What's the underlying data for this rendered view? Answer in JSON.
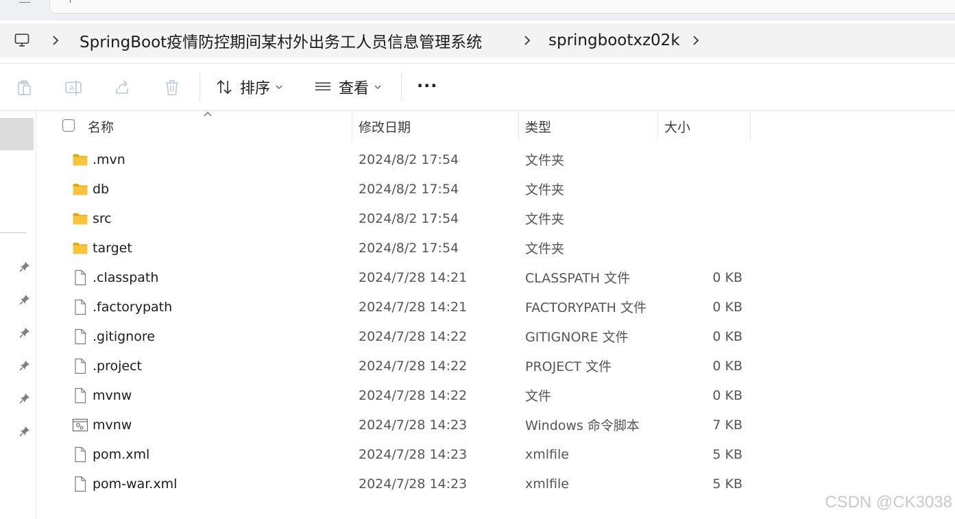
{
  "breadcrumb": {
    "items": [
      {
        "label": "SpringBoot疫情防控期间某村外出务工人员信息管理系统"
      },
      {
        "label": "springbootxz02k"
      }
    ]
  },
  "toolbar": {
    "sort_label": "排序",
    "view_label": "查看",
    "more_label": "···"
  },
  "columns": {
    "name": "名称",
    "date": "修改日期",
    "type": "类型",
    "size": "大小"
  },
  "files": [
    {
      "name": ".mvn",
      "date": "2024/8/2 17:54",
      "type": "文件夹",
      "size": "",
      "icon": "folder-icon"
    },
    {
      "name": "db",
      "date": "2024/8/2 17:54",
      "type": "文件夹",
      "size": "",
      "icon": "folder-icon"
    },
    {
      "name": "src",
      "date": "2024/8/2 17:54",
      "type": "文件夹",
      "size": "",
      "icon": "folder-icon"
    },
    {
      "name": "target",
      "date": "2024/8/2 17:54",
      "type": "文件夹",
      "size": "",
      "icon": "folder-icon"
    },
    {
      "name": ".classpath",
      "date": "2024/7/28 14:21",
      "type": "CLASSPATH 文件",
      "size": "0 KB",
      "icon": "file-icon"
    },
    {
      "name": ".factorypath",
      "date": "2024/7/28 14:21",
      "type": "FACTORYPATH 文件",
      "size": "0 KB",
      "icon": "file-icon"
    },
    {
      "name": ".gitignore",
      "date": "2024/7/28 14:22",
      "type": "GITIGNORE 文件",
      "size": "0 KB",
      "icon": "file-icon"
    },
    {
      "name": ".project",
      "date": "2024/7/28 14:22",
      "type": "PROJECT 文件",
      "size": "0 KB",
      "icon": "file-icon"
    },
    {
      "name": "mvnw",
      "date": "2024/7/28 14:22",
      "type": "文件",
      "size": "0 KB",
      "icon": "file-icon"
    },
    {
      "name": "mvnw",
      "date": "2024/7/28 14:23",
      "type": "Windows 命令脚本",
      "size": "7 KB",
      "icon": "script-icon"
    },
    {
      "name": "pom.xml",
      "date": "2024/7/28 14:23",
      "type": "xmlfile",
      "size": "5 KB",
      "icon": "file-icon"
    },
    {
      "name": "pom-war.xml",
      "date": "2024/7/28 14:23",
      "type": "xmlfile",
      "size": "5 KB",
      "icon": "file-icon"
    }
  ],
  "watermark": "CSDN @CK3038",
  "colors": {
    "folder": "#f8c53a",
    "folder_dark": "#e0a81c",
    "selection": "#dcdcdc"
  }
}
